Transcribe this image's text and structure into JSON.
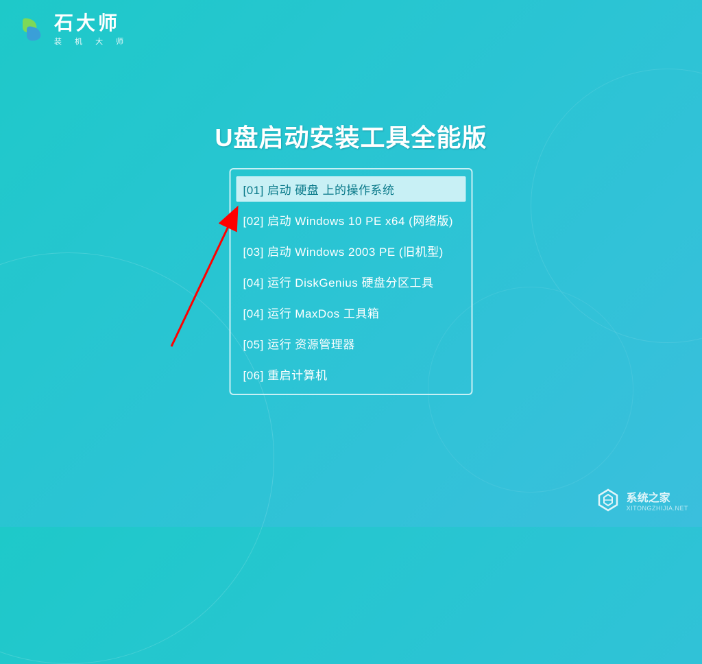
{
  "logo": {
    "title": "石大师",
    "subtitle": "装 机 大 师"
  },
  "main_title": "U盘启动安装工具全能版",
  "menu": {
    "items": [
      {
        "label": "[01] 启动 硬盘 上的操作系统",
        "selected": true
      },
      {
        "label": "[02] 启动 Windows 10 PE x64 (网络版)",
        "selected": false
      },
      {
        "label": "[03] 启动 Windows 2003 PE (旧机型)",
        "selected": false
      },
      {
        "label": "[04] 运行 DiskGenius 硬盘分区工具",
        "selected": false
      },
      {
        "label": "[04] 运行 MaxDos 工具箱",
        "selected": false
      },
      {
        "label": "[05] 运行 资源管理器",
        "selected": false
      },
      {
        "label": "[06] 重启计算机",
        "selected": false
      }
    ]
  },
  "watermark": {
    "title": "系统之家",
    "url": "XITONGZHIJIA.NET"
  }
}
